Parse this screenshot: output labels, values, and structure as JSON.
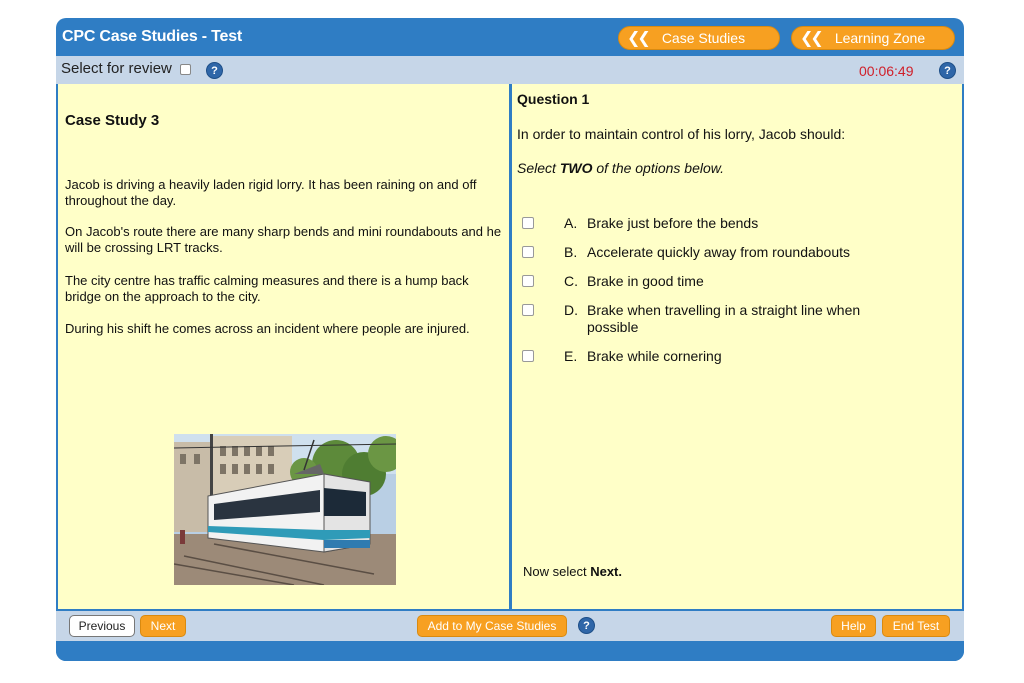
{
  "header": {
    "title": "CPC Case Studies - Test",
    "case_studies_label": "Case Studies",
    "learning_zone_label": "Learning Zone"
  },
  "subbar": {
    "review_label": "Select for review",
    "timer": "00:06:49",
    "help_symbol": "?"
  },
  "case_study": {
    "title": "Case Study 3",
    "paragraphs": [
      "Jacob is driving a heavily laden rigid lorry. It has been raining on and off throughout the day.",
      "On Jacob's route there are many sharp bends and mini roundabouts and he will be crossing LRT tracks.",
      "The city centre has traffic calming measures and there is a hump back bridge on the approach to the city.",
      "During his shift he comes across an incident where people are injured."
    ]
  },
  "question": {
    "title": "Question 1",
    "text": "In order to maintain control of his lorry, Jacob should:",
    "instruction_pre": "Select ",
    "instruction_bold": "TWO",
    "instruction_post": " of the options below.",
    "options": [
      {
        "letter": "A.",
        "text": "Brake just before the bends",
        "checked": false
      },
      {
        "letter": "B.",
        "text": "Accelerate quickly away from roundabouts",
        "checked": false
      },
      {
        "letter": "C.",
        "text": "Brake in good time",
        "checked": false
      },
      {
        "letter": "D.",
        "text": "Brake when travelling in a straight line when possible",
        "checked": false
      },
      {
        "letter": "E.",
        "text": "Brake while cornering",
        "checked": false
      }
    ],
    "now_select_pre": "Now select ",
    "now_select_bold": "Next."
  },
  "bottombar": {
    "previous_label": "Previous",
    "next_label": "Next",
    "add_label": "Add to My Case Studies",
    "help_label": "Help",
    "end_test_label": "End Test"
  },
  "colors": {
    "frame_blue": "#2f7dc4",
    "panel_yellow": "#ffffc8",
    "bar_grey_blue": "#c6d6e8",
    "button_orange": "#f7a021",
    "timer_red": "#d0202a"
  },
  "icons": {
    "nav": "double-chevron-left-icon",
    "help": "question-circle-icon"
  }
}
